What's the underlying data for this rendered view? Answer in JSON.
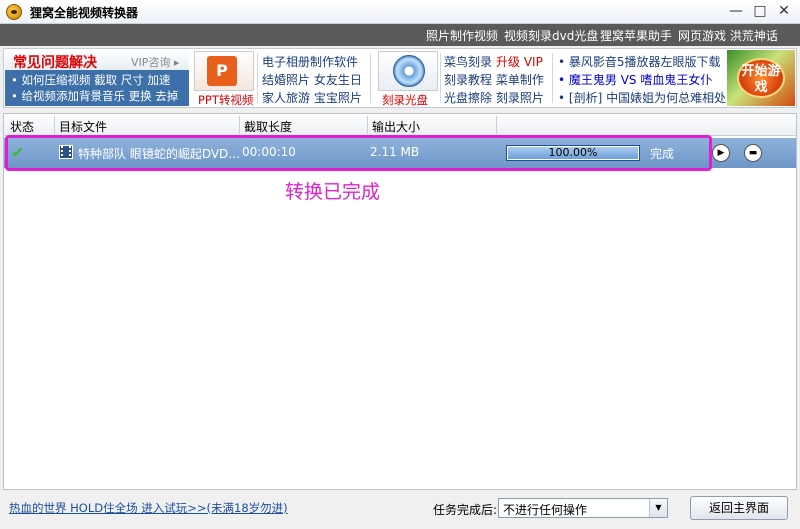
{
  "window": {
    "title": "狸窝全能视频转换器",
    "minimize": "—",
    "maximize": "□",
    "close": "✕"
  },
  "toplinks": [
    "照片制作视频",
    "视频刻录dvd光盘",
    "狸窝苹果助手",
    "网页游戏 洪荒神话"
  ],
  "banner": {
    "faq_title": "常见问题解决",
    "vip": "VIP咨询 ▸",
    "faq_lines": [
      "• 如何压缩视频 截取 尺寸 加速",
      "• 给视频添加背景音乐 更换 去掉"
    ],
    "ppt_icon": "P",
    "ppt_label": "PPT转视频",
    "col1": [
      "电子相册制作软件",
      "结婚照片 女友生日",
      "家人旅游 宝宝照片"
    ],
    "dvd_label": "刻录光盘",
    "col2_row1_a": "菜鸟刻录",
    "col2_row1_b": "升级 VIP",
    "col2_row2": "刻录教程 菜单制作",
    "col2_row3": "光盘擦除 刻录照片",
    "col3_row1": "• 暴风影音5播放器左眼版下载 ↓",
    "col3_row2": "• 魔王鬼男 VS 嗜血鬼王女仆",
    "col3_row3": "• [剖析] 中国婊姐为何总难相处",
    "game_label": "开始游戏"
  },
  "table": {
    "headers": [
      "状态",
      "目标文件",
      "截取长度",
      "输出大小"
    ],
    "row": {
      "status_icon": "✔",
      "file": "特种部队 眼镜蛇的崛起DVD…",
      "duration": "00:00:10",
      "size": "2.11 MB",
      "progress": 1.0,
      "progress_text": "100.00%",
      "state": "完成",
      "play_icon": "▶",
      "folder_icon": "▬"
    },
    "annotation": "转换已完成"
  },
  "bottom": {
    "promo": "热血的世界 HOLD住全场 进入试玩>>(未满18岁勿进)",
    "after_label": "任务完成后:",
    "after_value": "不进行任何操作",
    "select_arrow": "▼",
    "back_button": "返回主界面"
  },
  "colors": {
    "highlight": "#e020d0",
    "row_bg": "#7aa2d0",
    "accent_red": "#e30000"
  }
}
